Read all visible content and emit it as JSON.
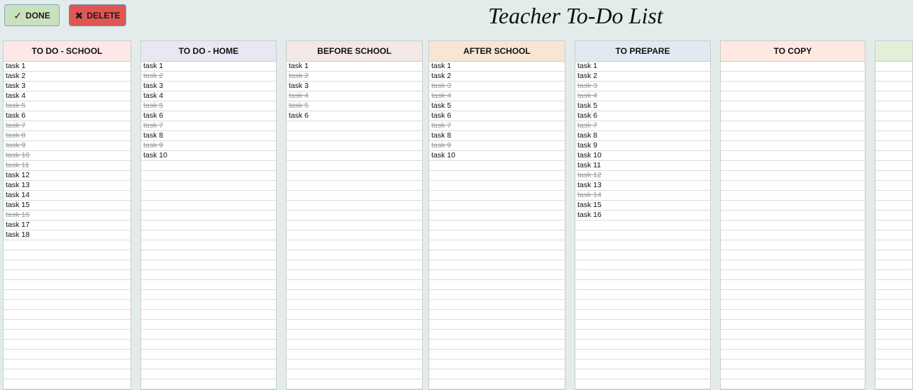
{
  "toolbar": {
    "done_label": "DONE",
    "delete_label": "DELETE",
    "done_icon": "check-icon",
    "delete_icon": "x-icon"
  },
  "title": "Teacher To-Do List",
  "columns": [
    {
      "id": "todo-school",
      "title": "TO DO - SCHOOL",
      "color": "#fde8e8",
      "tasks": [
        {
          "text": "task 1",
          "done": false
        },
        {
          "text": "task 2",
          "done": false
        },
        {
          "text": "task 3",
          "done": false
        },
        {
          "text": "task 4",
          "done": false
        },
        {
          "text": "task 5",
          "done": true
        },
        {
          "text": "task 6",
          "done": false
        },
        {
          "text": "task 7",
          "done": true
        },
        {
          "text": "task 8",
          "done": true
        },
        {
          "text": "task 9",
          "done": true
        },
        {
          "text": "task 10",
          "done": true
        },
        {
          "text": "task 11",
          "done": true
        },
        {
          "text": "task 12",
          "done": false
        },
        {
          "text": "task 13",
          "done": false
        },
        {
          "text": "task 14",
          "done": false
        },
        {
          "text": "task 15",
          "done": false
        },
        {
          "text": "task 16",
          "done": true
        },
        {
          "text": "task 17",
          "done": false
        },
        {
          "text": "task 18",
          "done": false
        }
      ]
    },
    {
      "id": "todo-home",
      "title": "TO DO - HOME",
      "color": "#e7e8f3",
      "tasks": [
        {
          "text": "task 1",
          "done": false
        },
        {
          "text": "task 2",
          "done": true
        },
        {
          "text": "task 3",
          "done": false
        },
        {
          "text": "task 4",
          "done": false
        },
        {
          "text": "task 5",
          "done": true
        },
        {
          "text": "task 6",
          "done": false
        },
        {
          "text": "task 7",
          "done": true
        },
        {
          "text": "task 8",
          "done": false
        },
        {
          "text": "task 9",
          "done": true
        },
        {
          "text": "task 10",
          "done": false
        }
      ]
    },
    {
      "id": "before-school",
      "title": "BEFORE SCHOOL",
      "color": "#f4e7e7",
      "tasks": [
        {
          "text": "task 1",
          "done": false
        },
        {
          "text": "task 2",
          "done": true
        },
        {
          "text": "task 3",
          "done": false
        },
        {
          "text": "task 4",
          "done": true
        },
        {
          "text": "task 5",
          "done": true
        },
        {
          "text": "task 6",
          "done": false
        }
      ]
    },
    {
      "id": "after-school",
      "title": "AFTER SCHOOL",
      "color": "#f8e6d4",
      "tasks": [
        {
          "text": "task 1",
          "done": false
        },
        {
          "text": "task 2",
          "done": false
        },
        {
          "text": "task 3",
          "done": true
        },
        {
          "text": "task 4",
          "done": true
        },
        {
          "text": "task 5",
          "done": false
        },
        {
          "text": "task 6",
          "done": false
        },
        {
          "text": "task 7",
          "done": true
        },
        {
          "text": "task 8",
          "done": false
        },
        {
          "text": "task 9",
          "done": true
        },
        {
          "text": "task 10",
          "done": false
        }
      ]
    },
    {
      "id": "to-prepare",
      "title": "TO PREPARE",
      "color": "#e1eaf2",
      "tasks": [
        {
          "text": "task 1",
          "done": false
        },
        {
          "text": "task 2",
          "done": false
        },
        {
          "text": "task 3",
          "done": true
        },
        {
          "text": "task 4",
          "done": true
        },
        {
          "text": "task 5",
          "done": false
        },
        {
          "text": "task 6",
          "done": false
        },
        {
          "text": "task 7",
          "done": true
        },
        {
          "text": "task 8",
          "done": false
        },
        {
          "text": "task 9",
          "done": false
        },
        {
          "text": "task 10",
          "done": false
        },
        {
          "text": "task 11",
          "done": false
        },
        {
          "text": "task 12",
          "done": true
        },
        {
          "text": "task 13",
          "done": false
        },
        {
          "text": "task 14",
          "done": true
        },
        {
          "text": "task 15",
          "done": false
        },
        {
          "text": "task 16",
          "done": false
        }
      ]
    },
    {
      "id": "to-copy",
      "title": "TO COPY",
      "color": "#fde9e2",
      "tasks": []
    },
    {
      "id": "partial-column",
      "title": "",
      "color": "#e4efd9",
      "tasks": []
    }
  ]
}
